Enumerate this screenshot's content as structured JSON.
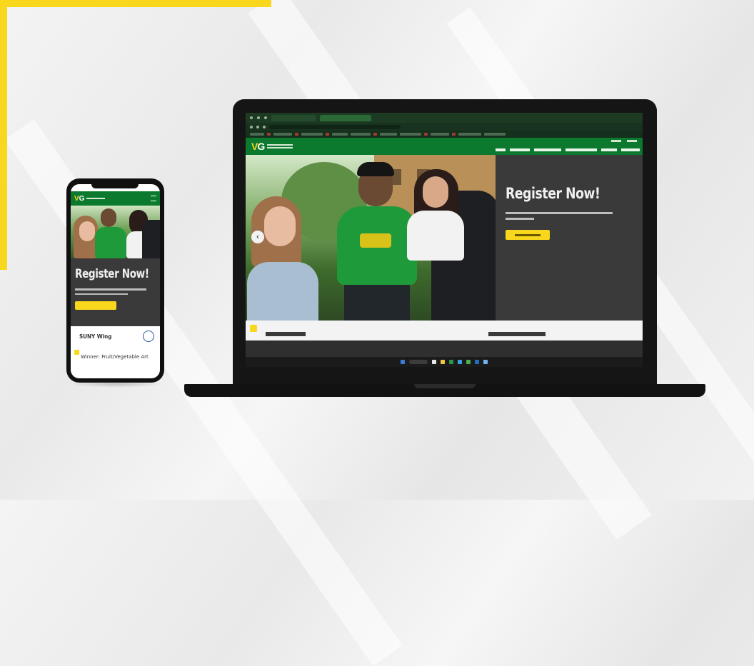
{
  "hero": {
    "title": "Register Now!"
  },
  "phone": {
    "hero_title": "Register Now!",
    "card_title": "SUNY Wing",
    "card_subtitle": "Winner: Fruit/Vegetable Art"
  },
  "brand": {
    "logo_primary": "V",
    "logo_secondary": "G",
    "green": "#0b7a2e",
    "yellow": "#f9d71c",
    "panel": "#3a3a3a"
  }
}
